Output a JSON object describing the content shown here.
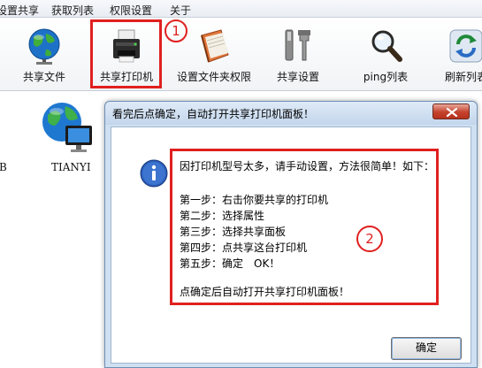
{
  "menubar": {
    "items": [
      {
        "label": "设置共享"
      },
      {
        "label": "获取列表"
      },
      {
        "label": "权限设置"
      },
      {
        "label": "关于"
      }
    ]
  },
  "toolbar": {
    "items": [
      {
        "label": "共享文件",
        "icon": "globe-icon"
      },
      {
        "label": "共享打印机",
        "icon": "printer-icon"
      },
      {
        "label": "设置文件夹权限",
        "icon": "folder-book-icon"
      },
      {
        "label": "共享设置",
        "icon": "tools-icon"
      },
      {
        "label": "ping列表",
        "icon": "magnifier-icon"
      },
      {
        "label": "刷新列表",
        "icon": "refresh-icon"
      }
    ]
  },
  "annotations": {
    "marker_1": "1",
    "marker_2": "2"
  },
  "content": {
    "devices": [
      {
        "name": "B"
      },
      {
        "name": "TIANYI"
      }
    ]
  },
  "dialog": {
    "title": "看完后点确定，自动打开共享打印机面板！",
    "lines": [
      "因打印机型号太多，请手动设置，方法很简单！如下：",
      "第一步：右击你要共享的打印机",
      "第二步：选择属性",
      "第三步：选择共享面板",
      "第四步：点共享这台打印机",
      "第五步：确定　OK！",
      "点确定后自动打开共享打印机面板！"
    ],
    "ok_label": "确定"
  },
  "colors": {
    "annotation_red": "#e02020",
    "dialog_frame": "#cfe0f2",
    "close_red": "#c4412c"
  }
}
